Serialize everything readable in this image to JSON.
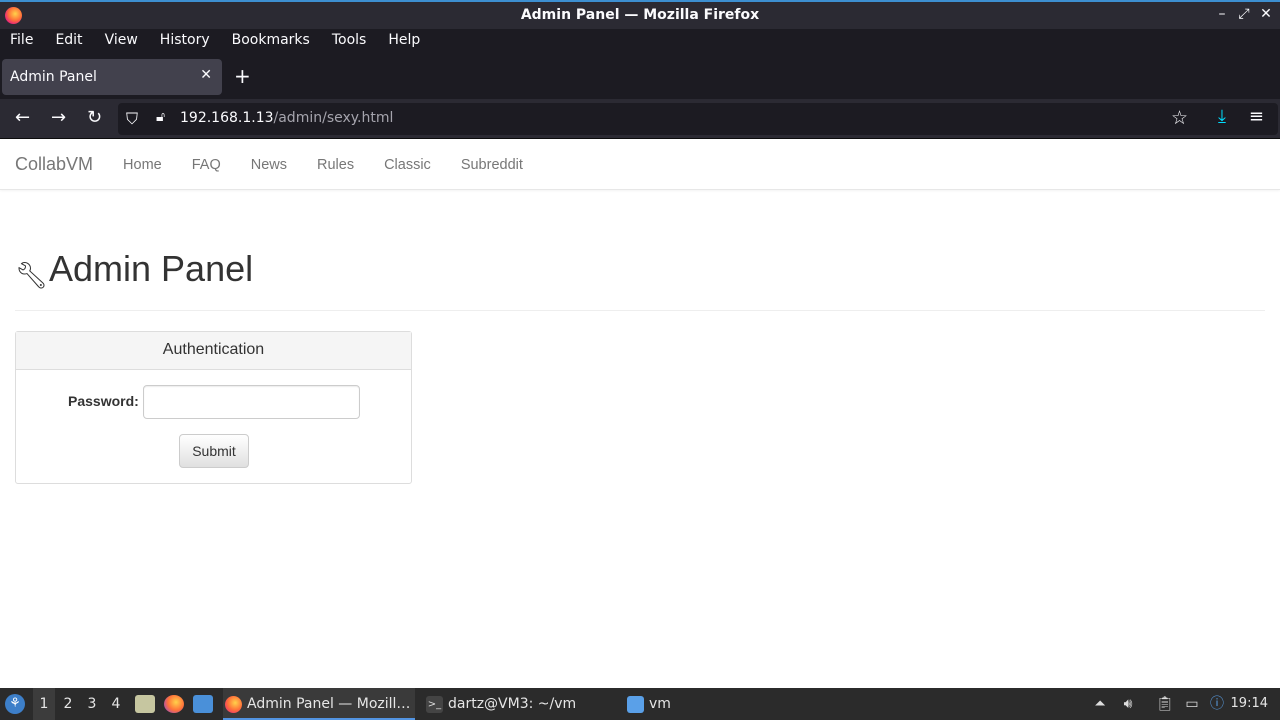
{
  "window": {
    "title": "Admin Panel — Mozilla Firefox"
  },
  "menubar": {
    "items": [
      "File",
      "Edit",
      "View",
      "History",
      "Bookmarks",
      "Tools",
      "Help"
    ]
  },
  "tab": {
    "title": "Admin Panel",
    "close": "✕"
  },
  "urlbar": {
    "host": "192.168.1.13",
    "path": "/admin/sexy.html"
  },
  "site": {
    "brand": "CollabVM",
    "nav": [
      "Home",
      "FAQ",
      "News",
      "Rules",
      "Classic",
      "Subreddit"
    ]
  },
  "page": {
    "title": "Admin Panel"
  },
  "panel": {
    "heading": "Authentication",
    "password_label": "Password:",
    "password_value": "",
    "submit_label": "Submit"
  },
  "taskbar": {
    "workspaces": [
      "1",
      "2",
      "3",
      "4"
    ],
    "tasks": [
      {
        "label": "Admin Panel — Mozill…",
        "icon": "firefox-icon"
      },
      {
        "label": "dartz@VM3: ~/vm",
        "icon": "terminal-icon"
      },
      {
        "label": "vm",
        "icon": "folder-icon"
      }
    ],
    "clock": "19:14"
  },
  "colors": {
    "accent": "#00ddff",
    "titlebar": "#2b2a33",
    "taskbar": "#2b2b2b"
  }
}
